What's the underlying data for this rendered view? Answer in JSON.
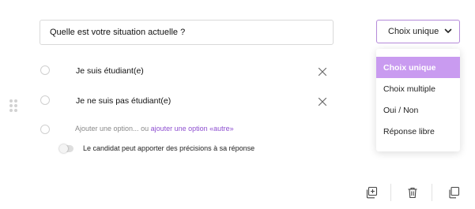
{
  "question": {
    "value": "Quelle est votre situation actuelle ?"
  },
  "type_select": {
    "selected": "Choix unique",
    "icon": "chevron-down-icon"
  },
  "dropdown": {
    "options": [
      "Choix unique",
      "Choix multiple",
      "Oui / Non",
      "Réponse libre"
    ],
    "active_index": 0,
    "active_color": "#c99bf0"
  },
  "answers": [
    {
      "label": "Je suis étudiant(e)"
    },
    {
      "label": "Je ne suis pas étudiant(e)"
    }
  ],
  "add_option": {
    "text": "Ajouter une option...",
    "or": "ou",
    "link": "ajouter une option «autre»"
  },
  "toggle": {
    "label": "Le candidat peut apporter des précisions à sa réponse",
    "on": false
  },
  "footer_actions": [
    "add-copy-icon",
    "trash-icon",
    "duplicate-icon"
  ],
  "colors": {
    "accent": "#8e4fd0",
    "select_border": "#b48ad9"
  }
}
